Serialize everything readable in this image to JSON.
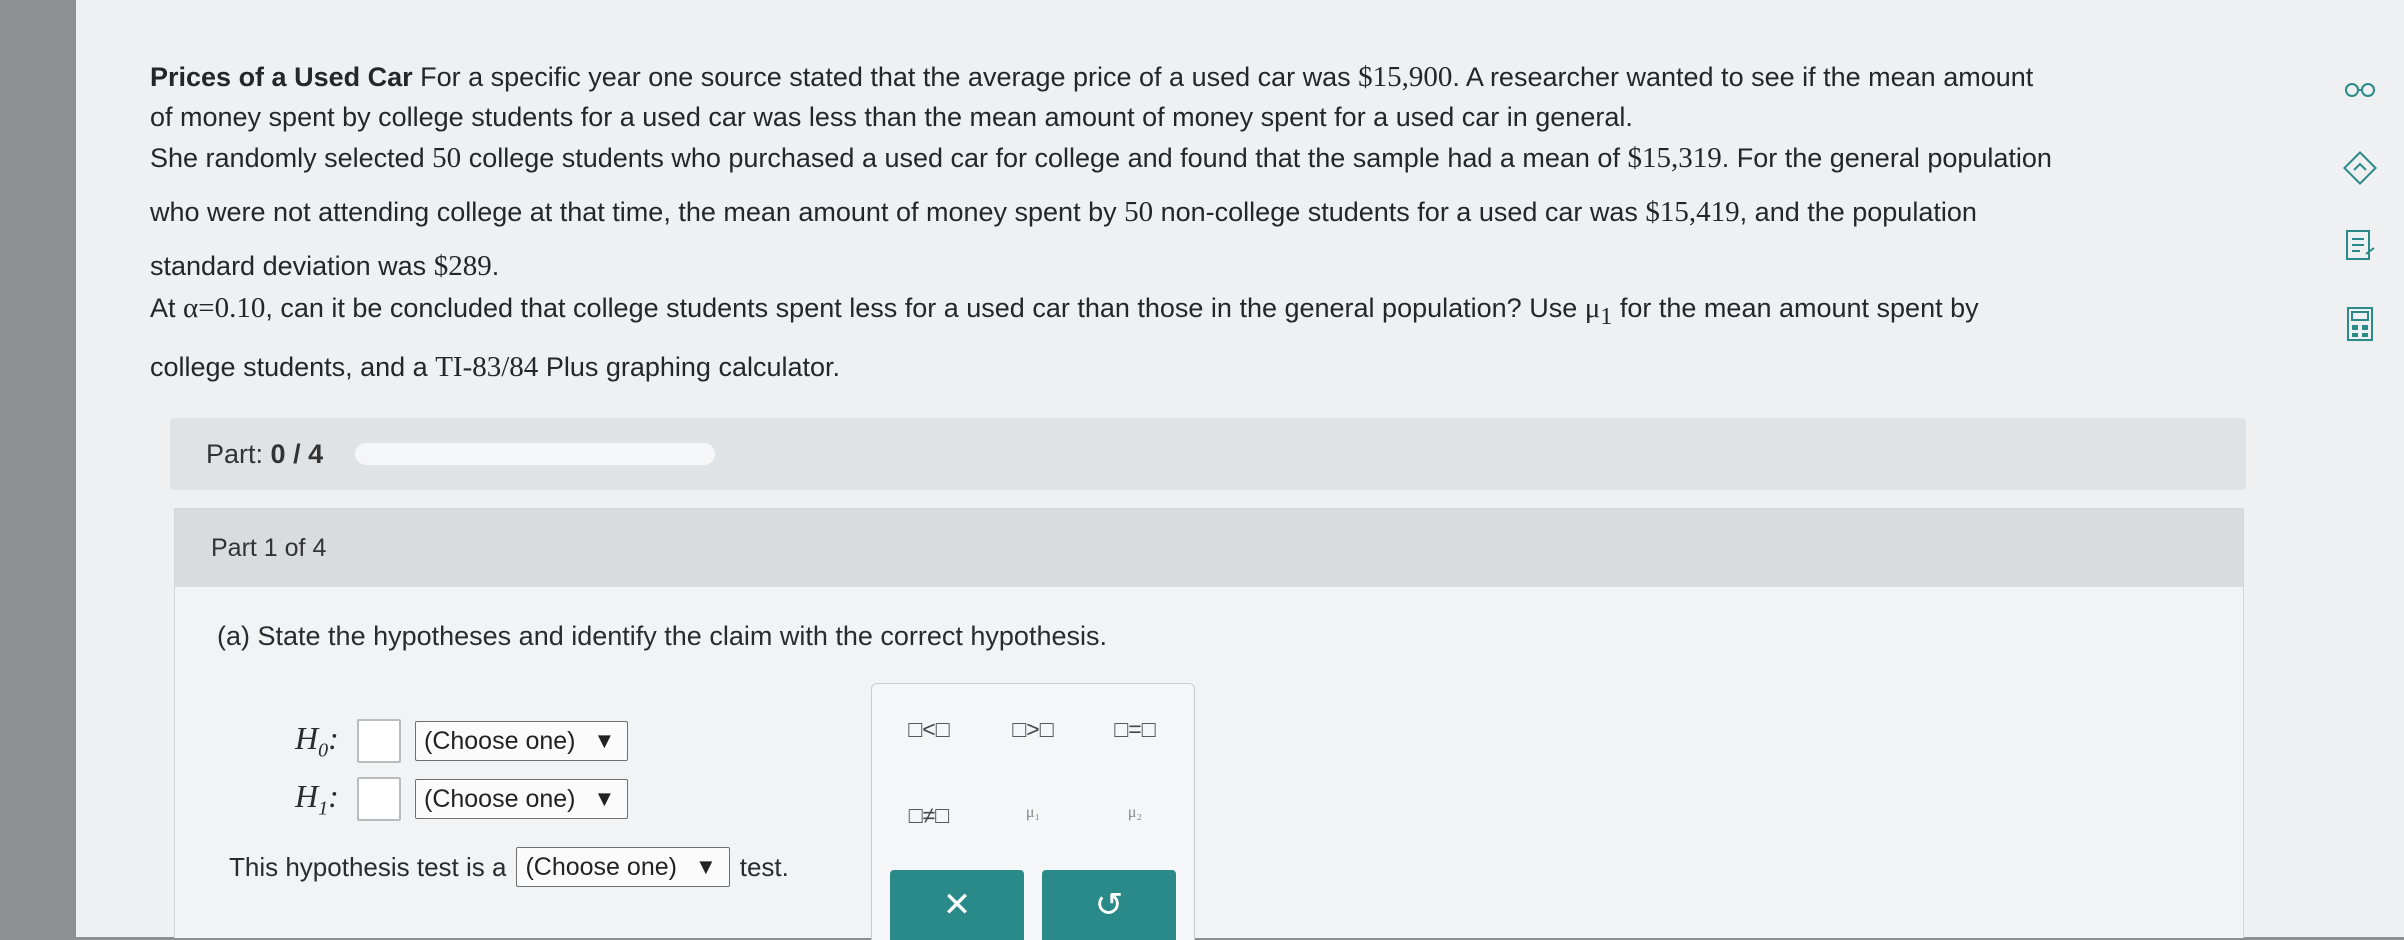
{
  "problem": {
    "title": "Prices of a Used Car",
    "p1_a": "For a specific year one source stated that the average price of a used car was",
    "p1_price": "$15,900",
    "p1_b": ". A researcher wanted to see if the mean amount",
    "p1_c": "of money spent by college students for a used car was less than the mean amount of money spent for a used car in general.",
    "p2_a": "She randomly selected",
    "p2_n1": "50",
    "p2_b": "college students who purchased a used car for college and found that the sample had a mean of",
    "p2_mean1": "$15,319",
    "p2_c": ". For the general population",
    "p2_d": "who were not attending college at that time, the mean amount of money spent by",
    "p2_n2": "50",
    "p2_e": "non-college students for a used car was",
    "p2_mean2": "$15,419",
    "p2_f": ", and the population",
    "p2_g": "standard deviation was",
    "p2_sd": "$289",
    "p2_h": ".",
    "p3_a": "At",
    "p3_alpha": "α=0.10",
    "p3_b": ", can it be concluded that college students spent less for a used car than those in the general population? Use",
    "p3_mu": "μ",
    "p3_mu_sub": "1",
    "p3_c": "for the mean amount spent by",
    "p3_d": "college students, and a",
    "p3_calc": "TI-83/84",
    "p3_e": "Plus graphing calculator."
  },
  "side_icons": [
    "glasses-icon",
    "review-icon",
    "notes-icon",
    "calculator-icon"
  ],
  "part_bar": {
    "prefix": "Part:",
    "value": "0 / 4",
    "progress": 0
  },
  "part": {
    "header": "Part 1 of 4",
    "question": "(a) State the hypotheses and identify the claim with the correct hypothesis.",
    "h0_letter": "H",
    "h0_sub": "0",
    "h1_letter": "H",
    "h1_sub": "1",
    "colon": ":",
    "choose": "(Choose one)",
    "test_prefix": "This hypothesis test is a",
    "test_suffix": "test."
  },
  "palette": {
    "less": "□<□",
    "greater": "□>□",
    "equal": "□=□",
    "not_equal": "□≠□",
    "mu1": "μ₁",
    "mu2": "μ₂",
    "clear": "✕",
    "undo": "↺"
  },
  "colors": {
    "accent": "#2a8a8a"
  }
}
